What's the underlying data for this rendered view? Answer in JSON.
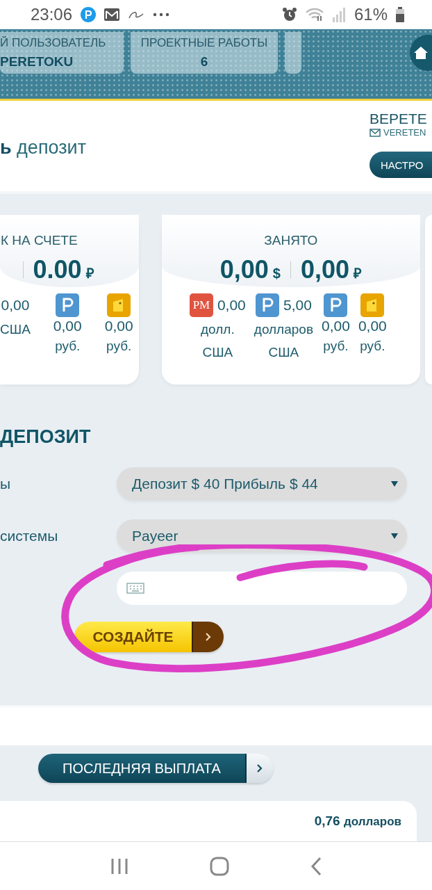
{
  "status_bar": {
    "time": "23:06",
    "battery": "61%"
  },
  "header": {
    "stats": [
      {
        "label": "Й ПОЛЬЗОВАТЕЛЬ",
        "value": "PERETOKU"
      },
      {
        "label": "ПРОЕКТНЫЕ РАБОТЫ",
        "value": "6"
      }
    ]
  },
  "title": "**ь** депозит",
  "user": {
    "name": "ВЕРЕТЕ",
    "email": "VERETEN",
    "settings_button": "НАСТРО"
  },
  "cards": [
    {
      "title": "К НА СЧЕТЕ",
      "totals": [
        {
          "amount": "0.00",
          "currency": "₽"
        }
      ],
      "wallets": [
        {
          "kind": "none",
          "amount": "0,00",
          "unit": [
            "США"
          ]
        },
        {
          "kind": "payeer",
          "amount": "0,00",
          "unit": [
            "руб."
          ]
        },
        {
          "kind": "yandex",
          "amount": "0,00",
          "unit": [
            "руб."
          ]
        }
      ]
    },
    {
      "title": "ЗАНЯТО",
      "totals": [
        {
          "amount": "0,00",
          "currency": "$"
        },
        {
          "amount": "0,00",
          "currency": "₽"
        }
      ],
      "wallets": [
        {
          "kind": "pm",
          "logo": "PM",
          "amount": "0,00",
          "unit": [
            "долл.",
            "США"
          ]
        },
        {
          "kind": "payeer",
          "amount": "5,00",
          "unit": [
            "долларов",
            "США"
          ]
        },
        {
          "kind": "payeer",
          "amount": "0,00",
          "unit": [
            "руб."
          ]
        },
        {
          "kind": "yandex",
          "amount": "0,00",
          "unit": [
            "руб."
          ]
        }
      ]
    }
  ],
  "form": {
    "heading": "ДЕПОЗИТ",
    "rows": [
      {
        "label": "ы",
        "value": "Депозит $ 40 Прибыль $ 44"
      },
      {
        "label": "системы",
        "value": "Payeer"
      }
    ],
    "submit": "СОЗДАЙТЕ"
  },
  "highlight_scribble": true,
  "payout": {
    "button": "ПОСЛЕДНЯЯ ВЫПЛАТА",
    "amount": "0,76",
    "unit": "долларов"
  }
}
